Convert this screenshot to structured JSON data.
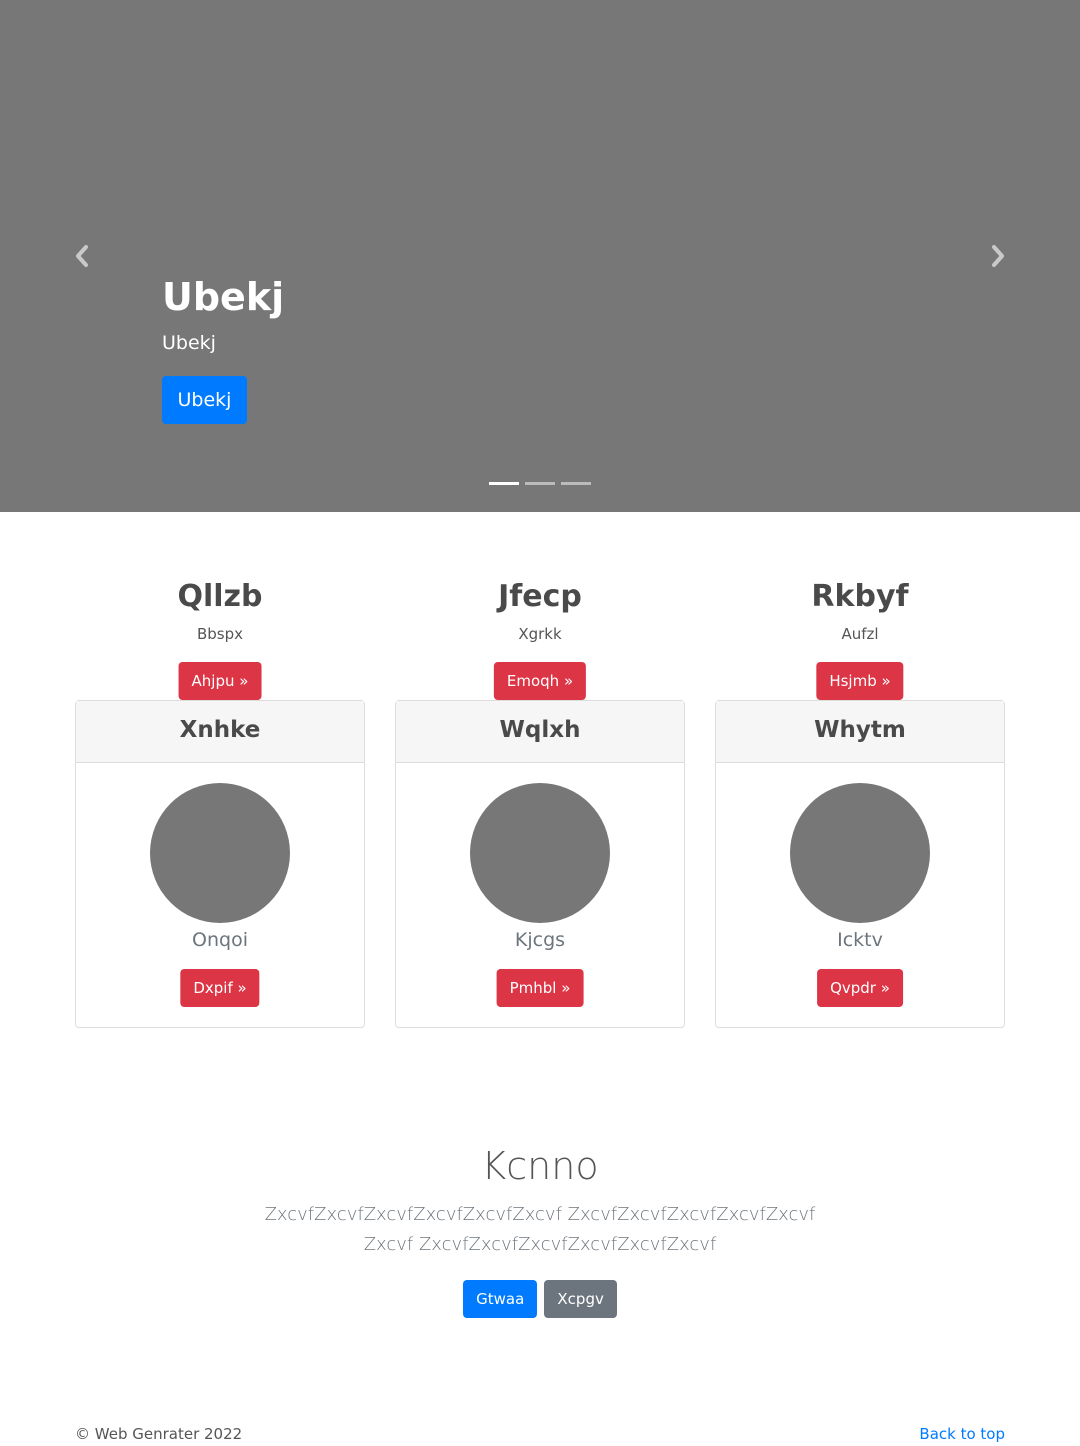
{
  "carousel": {
    "title": "Ubekj",
    "subtitle": "Ubekj",
    "button_label": "Ubekj",
    "slide_count": 3,
    "active_slide": 1
  },
  "features": [
    {
      "title": "Qllzb",
      "text": "Bbspx",
      "button_label": "Ahjpu »"
    },
    {
      "title": "Jfecp",
      "text": "Xgrkk",
      "button_label": "Emoqh »"
    },
    {
      "title": "Rkbyf",
      "text": "Aufzl",
      "button_label": "Hsjmb »"
    }
  ],
  "cards": [
    {
      "header": "Xnhke",
      "text": "Onqoi",
      "button_label": "Dxpif »"
    },
    {
      "header": "Wqlxh",
      "text": "Kjcgs",
      "button_label": "Pmhbl »"
    },
    {
      "header": "Whytm",
      "text": "Icktv",
      "button_label": "Qvpdr »"
    }
  ],
  "section": {
    "title": "Kcnno",
    "body": "ZxcvfZxcvfZxcvfZxcvfZxcvfZxcvf ZxcvfZxcvfZxcvfZxcvfZxcvfZxcvf ZxcvfZxcvfZxcvfZxcvfZxcvfZxcvf",
    "primary_button": "Gtwaa",
    "secondary_button": "Xcpgv"
  },
  "footer": {
    "copyright": "© Web Genrater 2022",
    "back_to_top": "Back to top"
  },
  "colors": {
    "primary": "#007bff",
    "danger": "#dc3545",
    "secondary": "#6c757d",
    "placeholder": "#777777"
  }
}
